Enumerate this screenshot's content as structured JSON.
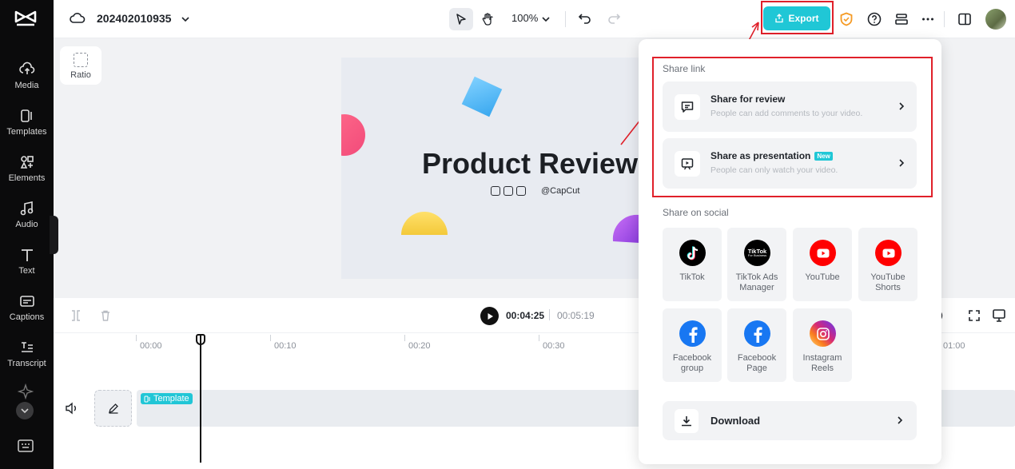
{
  "app": {
    "project_title": "202402010935",
    "zoom": "100%",
    "export_label": "Export",
    "ratio_label": "Ratio"
  },
  "sidebar": {
    "items": [
      {
        "label": "Media",
        "icon": "media-upload-icon"
      },
      {
        "label": "Templates",
        "icon": "templates-icon"
      },
      {
        "label": "Elements",
        "icon": "elements-icon"
      },
      {
        "label": "Audio",
        "icon": "audio-icon"
      },
      {
        "label": "Text",
        "icon": "text-icon"
      },
      {
        "label": "Captions",
        "icon": "captions-icon"
      },
      {
        "label": "Transcript",
        "icon": "transcript-icon"
      }
    ]
  },
  "preview": {
    "headline": "Product Review",
    "handle": "@CapCut"
  },
  "timeline": {
    "current_time": "00:04:25",
    "total_time": "00:05:19",
    "ruler": [
      "00:00",
      "00:10",
      "00:20",
      "00:30",
      "01:00"
    ],
    "clip_label": "Template"
  },
  "share_panel": {
    "share_link_title": "Share link",
    "review": {
      "title": "Share for review",
      "subtitle": "People can add comments to your video."
    },
    "presentation": {
      "title": "Share as presentation",
      "badge": "New",
      "subtitle": "People can only watch your video."
    },
    "social_title": "Share on social",
    "socials": [
      {
        "label": "TikTok"
      },
      {
        "label": "TikTok Ads Manager",
        "logo_text": "TikTok",
        "logo_sub": "For Business"
      },
      {
        "label": "YouTube"
      },
      {
        "label": "YouTube Shorts"
      },
      {
        "label": "Facebook group"
      },
      {
        "label": "Facebook Page"
      },
      {
        "label": "Instagram Reels"
      }
    ],
    "download_label": "Download"
  },
  "colors": {
    "accent": "#20c7d6",
    "highlight": "#e0202a",
    "youtube": "#ff0000",
    "facebook": "#1877f2"
  }
}
